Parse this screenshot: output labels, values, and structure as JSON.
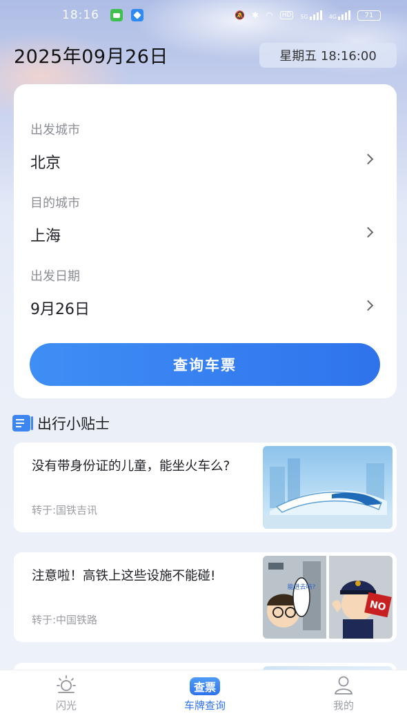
{
  "status_bar": {
    "time": "18:16",
    "network": "HD",
    "signal1": "5G",
    "signal2": "4G",
    "battery": "71"
  },
  "header": {
    "date": "2025年09月26日",
    "weekday_time": "星期五 18:16:00"
  },
  "form": {
    "from_label": "出发城市",
    "from_value": "北京",
    "to_label": "目的城市",
    "to_value": "上海",
    "date_label": "出发日期",
    "date_value": "9月26日",
    "submit_label": "查询车票"
  },
  "tips": {
    "title": "出行小贴士",
    "articles": [
      {
        "title": "没有带身份证的儿童，能坐火车么?",
        "source": "转于:国铁吉讯",
        "thumb_icon": "bullet-train-image"
      },
      {
        "title": "注意啦！高铁上这些设施不能碰!",
        "source": "转于:中国铁路",
        "thumb_icon": "cartoon-warning-image",
        "thumb_text": "NO",
        "bubble_text": "能进去吗?"
      }
    ]
  },
  "tabbar": {
    "items": [
      {
        "label": "闪光",
        "icon": "sun-icon"
      },
      {
        "label": "车牌查询",
        "icon": "ticket-icon",
        "badge": "查票"
      },
      {
        "label": "我的",
        "icon": "user-icon"
      }
    ],
    "active_index": 1
  },
  "colors": {
    "accent": "#2f73ec",
    "button_start": "#3f8ef5",
    "muted": "#8a8d94"
  }
}
